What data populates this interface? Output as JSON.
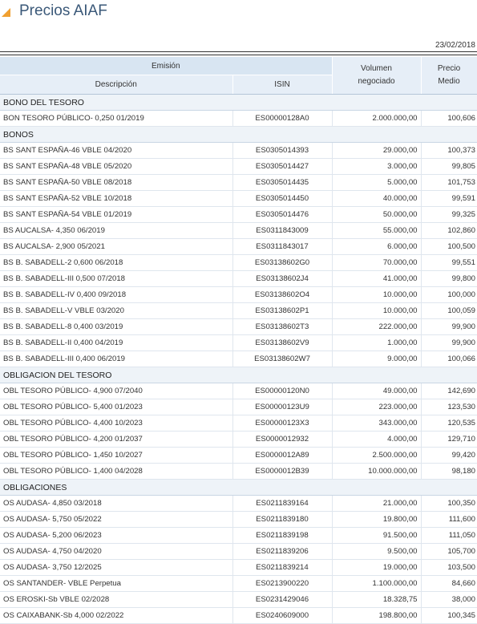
{
  "page": {
    "title": "Precios AIAF",
    "date": "23/02/2018"
  },
  "header": {
    "emision": "Emisión",
    "descripcion": "Descripción",
    "isin": "ISIN",
    "volumen_l1": "Volumen",
    "volumen_l2": "negociado",
    "precio_l1": "Precio",
    "precio_l2": "Medio"
  },
  "sections": [
    {
      "name": "BONO DEL TESORO",
      "rows": [
        [
          "BON TESORO PÚBLICO- 0,250 01/2019",
          "ES00000128A0",
          "2.000.000,00",
          "100,606"
        ]
      ]
    },
    {
      "name": "BONOS",
      "rows": [
        [
          "BS SANT ESPAÑA-46 VBLE 04/2020",
          "ES0305014393",
          "29.000,00",
          "100,373"
        ],
        [
          "BS SANT ESPAÑA-48 VBLE 05/2020",
          "ES0305014427",
          "3.000,00",
          "99,805"
        ],
        [
          "BS SANT ESPAÑA-50 VBLE 08/2018",
          "ES0305014435",
          "5.000,00",
          "101,753"
        ],
        [
          "BS SANT ESPAÑA-52 VBLE 10/2018",
          "ES0305014450",
          "40.000,00",
          "99,591"
        ],
        [
          "BS SANT ESPAÑA-54 VBLE 01/2019",
          "ES0305014476",
          "50.000,00",
          "99,325"
        ],
        [
          "BS AUCALSA- 4,350 06/2019",
          "ES0311843009",
          "55.000,00",
          "102,860"
        ],
        [
          "BS AUCALSA- 2,900 05/2021",
          "ES0311843017",
          "6.000,00",
          "100,500"
        ],
        [
          "BS B. SABADELL-2 0,600 06/2018",
          "ES03138602G0",
          "70.000,00",
          "99,551"
        ],
        [
          "BS B. SABADELL-III 0,500 07/2018",
          "ES03138602J4",
          "41.000,00",
          "99,800"
        ],
        [
          "BS B. SABADELL-IV 0,400 09/2018",
          "ES03138602O4",
          "10.000,00",
          "100,000"
        ],
        [
          "BS B. SABADELL-V VBLE 03/2020",
          "ES03138602P1",
          "10.000,00",
          "100,059"
        ],
        [
          "BS B. SABADELL-8 0,400 03/2019",
          "ES03138602T3",
          "222.000,00",
          "99,900"
        ],
        [
          "BS B. SABADELL-II 0,400 04/2019",
          "ES03138602V9",
          "1.000,00",
          "99,900"
        ],
        [
          "BS B. SABADELL-III 0,400 06/2019",
          "ES03138602W7",
          "9.000,00",
          "100,066"
        ]
      ]
    },
    {
      "name": "OBLIGACION DEL TESORO",
      "rows": [
        [
          "OBL TESORO PÚBLICO- 4,900 07/2040",
          "ES00000120N0",
          "49.000,00",
          "142,690"
        ],
        [
          "OBL TESORO PÚBLICO- 5,400 01/2023",
          "ES00000123U9",
          "223.000,00",
          "123,530"
        ],
        [
          "OBL TESORO PÚBLICO- 4,400 10/2023",
          "ES00000123X3",
          "343.000,00",
          "120,535"
        ],
        [
          "OBL TESORO PÚBLICO- 4,200 01/2037",
          "ES0000012932",
          "4.000,00",
          "129,710"
        ],
        [
          "OBL TESORO PÚBLICO- 1,450 10/2027",
          "ES0000012A89",
          "2.500.000,00",
          "99,420"
        ],
        [
          "OBL TESORO PÚBLICO- 1,400 04/2028",
          "ES0000012B39",
          "10.000.000,00",
          "98,180"
        ]
      ]
    },
    {
      "name": "OBLIGACIONES",
      "rows": [
        [
          "OS AUDASA- 4,850 03/2018",
          "ES0211839164",
          "21.000,00",
          "100,350"
        ],
        [
          "OS AUDASA- 5,750 05/2022",
          "ES0211839180",
          "19.800,00",
          "111,600"
        ],
        [
          "OS AUDASA- 5,200 06/2023",
          "ES0211839198",
          "91.500,00",
          "111,050"
        ],
        [
          "OS AUDASA- 4,750 04/2020",
          "ES0211839206",
          "9.500,00",
          "105,700"
        ],
        [
          "OS AUDASA- 3,750 12/2025",
          "ES0211839214",
          "19.000,00",
          "103,500"
        ],
        [
          "OS SANTANDER- VBLE Perpetua",
          "ES0213900220",
          "1.100.000,00",
          "84,660"
        ],
        [
          "OS EROSKI-Sb VBLE 02/2028",
          "ES0231429046",
          "18.328,75",
          "38,000"
        ],
        [
          "OS CAIXABANK-Sb 4,000 02/2022",
          "ES0240609000",
          "198.800,00",
          "100,345"
        ]
      ]
    }
  ]
}
